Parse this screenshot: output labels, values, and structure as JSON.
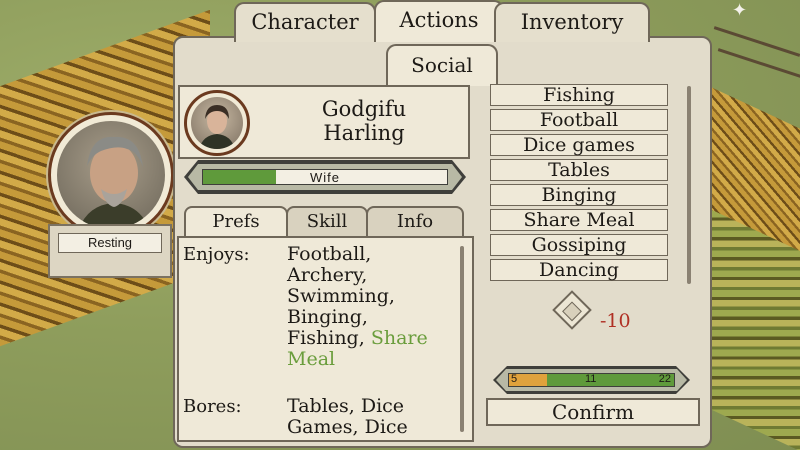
{
  "main_tabs": [
    {
      "label": "Character",
      "active": false
    },
    {
      "label": "Actions",
      "active": true
    },
    {
      "label": "Inventory",
      "active": false
    }
  ],
  "sub_tab": {
    "label": "Social"
  },
  "player": {
    "status": "Resting"
  },
  "character": {
    "first_name": "Godgifu",
    "last_name": "Harling",
    "relation": {
      "label": "Wife",
      "fill_percent": 30
    }
  },
  "pref_tabs": [
    {
      "label": "Prefs",
      "active": true
    },
    {
      "label": "Skill",
      "active": false
    },
    {
      "label": "Info",
      "active": false
    }
  ],
  "prefs": {
    "enjoys_label": "Enjoys:",
    "enjoys_text": "Football, Archery, Swimming, Binging, Fishing,",
    "enjoys_highlight": "Share Meal",
    "bores_label": "Bores:",
    "bores_text": "Tables, Dice Games, Dice"
  },
  "activities": [
    {
      "label": "Fishing"
    },
    {
      "label": "Football"
    },
    {
      "label": "Dice games"
    },
    {
      "label": "Tables"
    },
    {
      "label": "Binging"
    },
    {
      "label": "Share Meal"
    },
    {
      "label": "Gossiping"
    },
    {
      "label": "Dancing"
    }
  ],
  "cost": {
    "value": "-10",
    "icon": "activity-cost-icon"
  },
  "mood": {
    "low": "5",
    "mid": "11",
    "high": "22",
    "low_value": 5,
    "mid_value": 11,
    "max_value": 22
  },
  "confirm_label": "Confirm",
  "colors": {
    "accent_green": "#5f9a3b",
    "cost_red": "#b03024",
    "mood_orange": "#e0a23c"
  }
}
